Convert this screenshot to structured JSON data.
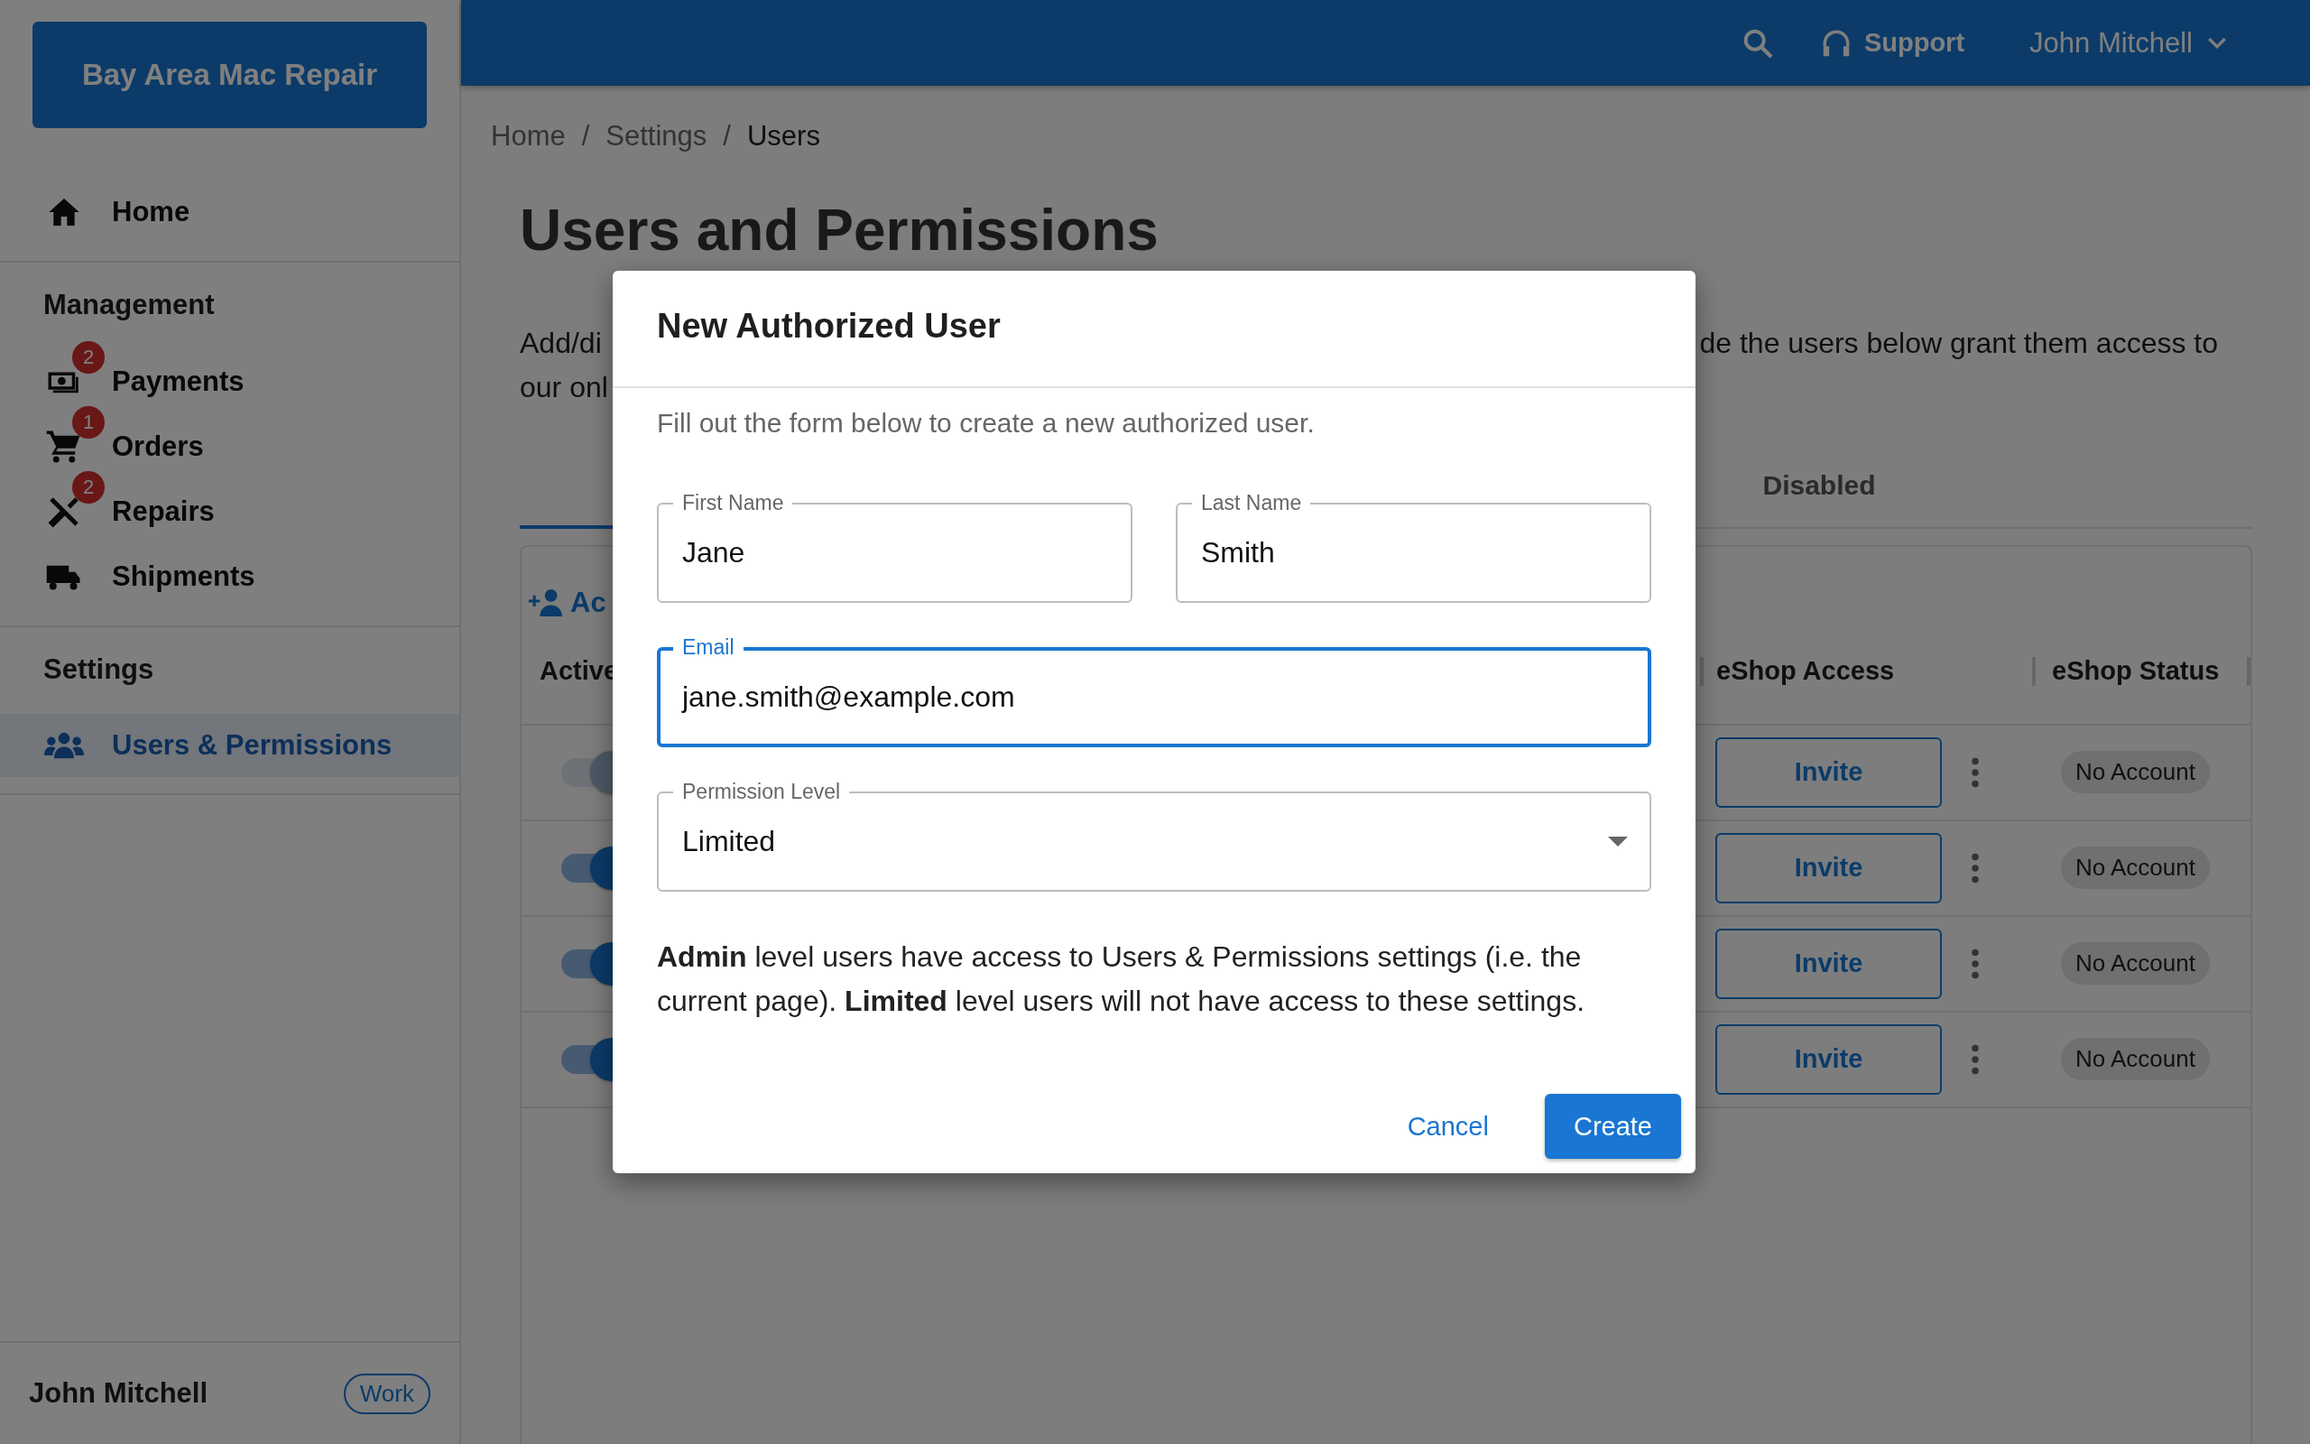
{
  "sidebar": {
    "logo": "Bay Area Mac Repair",
    "sections": [
      {
        "items": [
          {
            "label": "Home",
            "selected": false
          }
        ]
      },
      {
        "heading": "Management",
        "items": [
          {
            "label": "Payments",
            "badge": "2",
            "selected": false
          },
          {
            "label": "Orders",
            "badge": "1",
            "selected": false
          },
          {
            "label": "Repairs",
            "badge": "2",
            "selected": false
          },
          {
            "label": "Shipments",
            "selected": false
          }
        ]
      },
      {
        "heading": "Settings",
        "items": [
          {
            "label": "Users & Permissions",
            "selected": true
          }
        ]
      }
    ],
    "user": {
      "name": "John Mitchell",
      "tag": "Work"
    }
  },
  "header": {
    "support": "Support",
    "user": "John Mitchell"
  },
  "breadcrumbs": [
    {
      "label": "Home",
      "selected": false
    },
    {
      "separator": "/",
      "label": "Settings",
      "selected": false
    },
    {
      "separator": "/",
      "label": "Users",
      "selected": true
    }
  ],
  "page": {
    "title": "Users and Permissions",
    "description_left": [
      "Add/di",
      "our onl"
    ],
    "description_right": "de the users below grant them access to"
  },
  "tabs": [
    {
      "selected": true
    },
    {
      "label": "Disabled",
      "selected": false
    }
  ],
  "table": {
    "add_button": "Ac",
    "columns": [
      {
        "label": "Active"
      },
      {
        "label": "eShop Access"
      },
      {
        "label": "eShop Status"
      }
    ],
    "rows": [
      {
        "active": true,
        "disabled": true,
        "invite": "Invite",
        "status": "No Account"
      },
      {
        "active": true,
        "disabled": false,
        "invite": "Invite",
        "status": "No Account"
      },
      {
        "active": true,
        "disabled": false,
        "invite": "Invite",
        "status": "No Account"
      },
      {
        "active": true,
        "disabled": false,
        "invite": "Invite",
        "status": "No Account"
      }
    ]
  },
  "modal": {
    "title": "New Authorized User",
    "subtitle": "Fill out the form below to create a new authorized user.",
    "fields": [
      {
        "label": "First Name",
        "value": "Jane",
        "kind": "text",
        "focused": false
      },
      {
        "label": "Last Name",
        "value": "Smith",
        "kind": "text",
        "focused": false
      },
      {
        "label": "Email",
        "value": "jane.smith@example.com",
        "kind": "text",
        "focused": true
      },
      {
        "label": "Permission Level",
        "value": "Limited",
        "kind": "select",
        "focused": false
      }
    ],
    "help": "**Admin** level users have access to Users & Permissions settings (i.e. the current page). **Limited** level users will not have access to these settings.",
    "buttons": [
      {
        "label": "Cancel",
        "kind": "text"
      },
      {
        "label": "Create",
        "kind": "contained"
      }
    ]
  }
}
